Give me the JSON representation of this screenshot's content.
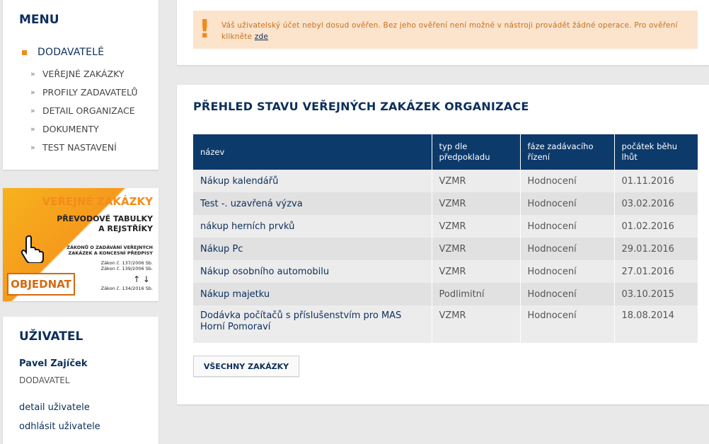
{
  "menu": {
    "heading": "MENU",
    "main_item": "DODAVATELÉ",
    "items": [
      {
        "label": "VEŘEJNÉ ZAKÁZKY"
      },
      {
        "label": "PROFILY ZADAVATELŮ"
      },
      {
        "label": "DETAIL ORGANIZACE"
      },
      {
        "label": "DOKUMENTY"
      },
      {
        "label": "TEST NASTAVENÍ"
      }
    ]
  },
  "banner": {
    "title": "VEŘEJNÉ ZAKÁZKY",
    "subtitle_1": "PŘEVODOVÉ TABULKY",
    "subtitle_2": "A REJSTŘÍKY",
    "small_1": "ZÁKONŮ O ZADÁVÁNÍ VEŘEJNÝCH",
    "small_2": "ZAKÁZEK A KONCESNÍ PŘEDPISY",
    "law_1": "Zákon č. 137/2006 Sb.",
    "law_2": "Zákon č. 139/2006 Sb.",
    "law_3": "Zákon č. 134/2016 Sb.",
    "arrows": "↑ ↓",
    "order_label": "OBJEDNAT",
    "accent_color": "#f59a1d"
  },
  "user": {
    "heading": "UŽIVATEL",
    "name": "Pavel Zajíček",
    "role": "DODAVATEL",
    "link_detail": "detail uživatele",
    "link_logout": "odhlásit uživatele"
  },
  "warning": {
    "text_1": "Váš uživatelský účet nebyl dosud ověřen. Bez jeho ověření není možné v nástroji provádět žádné operace. Pro ověření klikněte ",
    "link": "zde",
    "icon": "exclamation-icon"
  },
  "main": {
    "title": "PŘEHLED STAVU VEŘEJNÝCH ZAKÁZEK ORGANIZACE",
    "columns": [
      "název",
      "typ dle předpokladu",
      "fáze zadávacího řízení",
      "počátek běhu lhůt"
    ],
    "rows": [
      {
        "name": "Nákup kalendářů",
        "type": "VZMR",
        "phase": "Hodnocení",
        "start": "01.11.2016"
      },
      {
        "name": "Test -. uzavřená výzva",
        "type": "VZMR",
        "phase": "Hodnocení",
        "start": "03.02.2016"
      },
      {
        "name": "nákup herních prvků",
        "type": "VZMR",
        "phase": "Hodnocení",
        "start": "01.02.2016"
      },
      {
        "name": "Nákup Pc",
        "type": "VZMR",
        "phase": "Hodnocení",
        "start": "29.01.2016"
      },
      {
        "name": "Nákup osobního automobilu",
        "type": "VZMR",
        "phase": "Hodnocení",
        "start": "27.01.2016"
      },
      {
        "name": "Nákup majetku",
        "type": "Podlimitní",
        "phase": "Hodnocení",
        "start": "03.10.2015"
      },
      {
        "name": "Dodávka počítačů s příslušenstvím pro MAS Horní Pomoraví",
        "type": "VZMR",
        "phase": "Hodnocení",
        "start": "18.08.2014"
      }
    ],
    "all_button": "VŠECHNY ZAKÁZKY"
  },
  "colors": {
    "brand_navy": "#0c2f5c",
    "table_header": "#0c3a6b",
    "accent_orange": "#f08a1e",
    "warning_bg": "#fbe3cc"
  }
}
